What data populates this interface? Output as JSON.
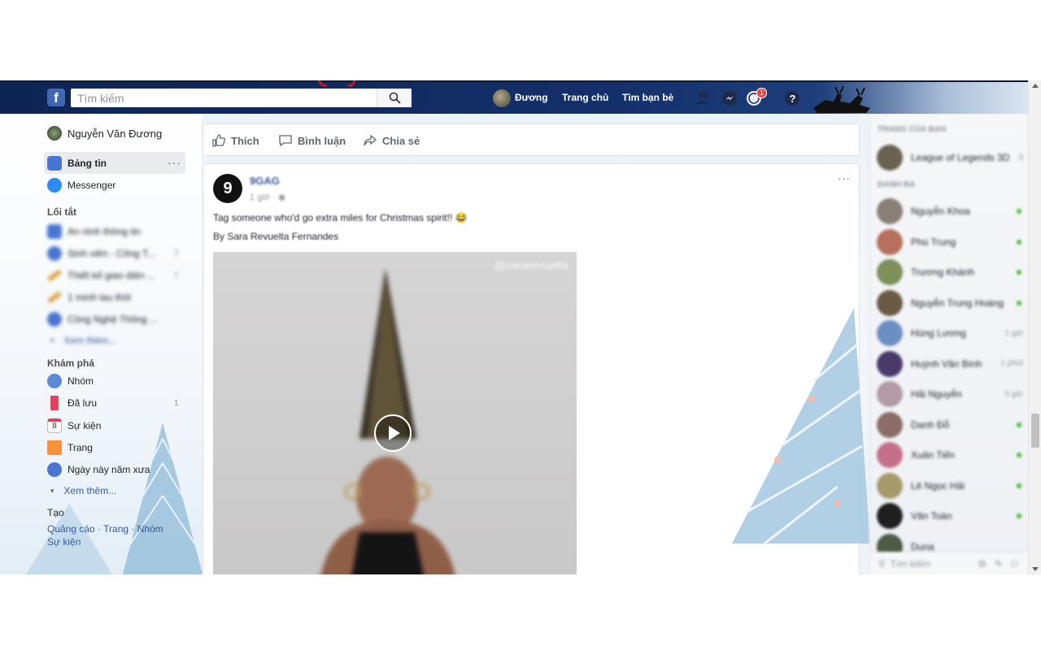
{
  "topbar": {
    "search_placeholder": "Tìm kiếm",
    "profile_name": "Đương",
    "home_label": "Trang chủ",
    "find_friends_label": "Tìm bạn bè",
    "notifications_count": "1"
  },
  "left_sidebar": {
    "user_name": "Nguyễn Văn Đương",
    "news_feed": "Bảng tin",
    "messenger": "Messenger",
    "shortcuts_heading": "Lối tắt",
    "shortcuts": [
      {
        "label": "An ninh thông tin",
        "count": ""
      },
      {
        "label": "Sinh viên - Công T...",
        "count": "2"
      },
      {
        "label": "Thiết kế giao diện ...",
        "count": "1"
      },
      {
        "label": "1 minh lau thôi",
        "count": ""
      },
      {
        "label": "Công Nghệ Thông ...",
        "count": ""
      }
    ],
    "see_more_1": "Xem thêm...",
    "explore_heading": "Khám phá",
    "explore": [
      {
        "label": "Nhóm",
        "count": ""
      },
      {
        "label": "Đã lưu",
        "count": "1"
      },
      {
        "label": "Sự kiện",
        "count": ""
      },
      {
        "label": "Trang",
        "count": ""
      },
      {
        "label": "Ngày này năm xưa",
        "count": ""
      }
    ],
    "calendar_day": "8",
    "see_more_2": "Xem thêm...",
    "create_heading": "Tạo",
    "create_links": [
      "Quảng cáo",
      "Trang",
      "Nhóm",
      "Sự kiện"
    ]
  },
  "previous_post_actions": {
    "like": "Thích",
    "comment": "Bình luận",
    "share": "Chia sẻ"
  },
  "post": {
    "author": "9GAG",
    "time": "1 giờ ·",
    "text": "Tag someone who'd go extra miles for Christmas spirit!! 😂",
    "credit": "By Sara Revuelta Fernandes",
    "watermark": "@sararevuelta",
    "more": "···"
  },
  "right_sidebar": {
    "pages_heading": "TRANG CỦA BẠN",
    "page": {
      "name": "League of Legends 3D",
      "count": "3"
    },
    "contacts_heading": "DANH BẠ",
    "contacts": [
      {
        "name": "Nguyễn Khoa",
        "status": "online"
      },
      {
        "name": "Phú Trung",
        "status": "online"
      },
      {
        "name": "Trương Khánh",
        "status": "online"
      },
      {
        "name": "Nguyễn Trung Hoàng",
        "status": "online"
      },
      {
        "name": "Hùng Lương",
        "status": "1 giờ"
      },
      {
        "name": "Huỳnh Văn Bình",
        "status": "1 phút"
      },
      {
        "name": "Hải Nguyễn",
        "status": "5 giờ"
      },
      {
        "name": "Danh Đỗ",
        "status": "online"
      },
      {
        "name": "Xuân Tiến",
        "status": "online"
      },
      {
        "name": "Lê Ngọc Hải",
        "status": "online"
      },
      {
        "name": "Văn Toàn",
        "status": "online"
      },
      {
        "name": "Duna",
        "status": ""
      }
    ],
    "search_placeholder": "Tìm kiếm"
  },
  "colors": {
    "topbar": "#13306a",
    "link": "#365899",
    "online": "#42b72a",
    "badge": "#fa3e3e"
  }
}
